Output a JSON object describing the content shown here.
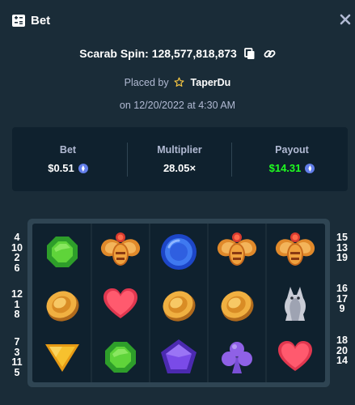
{
  "modal": {
    "title": "Bet"
  },
  "spin": {
    "label": "Scarab Spin: 128,577,818,873"
  },
  "placed": {
    "prefix": "Placed by",
    "user": "TaperDu"
  },
  "date": "on 12/20/2022 at 4:30 AM",
  "stats": {
    "bet": {
      "label": "Bet",
      "value": "$0.51"
    },
    "multiplier": {
      "label": "Multiplier",
      "value": "28.05×"
    },
    "payout": {
      "label": "Payout",
      "value": "$14.31"
    }
  },
  "paylines": {
    "left": [
      [
        "4",
        "10",
        "2",
        "6"
      ],
      [
        "12",
        "1",
        "8"
      ],
      [
        "7",
        "3",
        "11",
        "5"
      ]
    ],
    "right": [
      [
        "15",
        "13",
        "19"
      ],
      [
        "16",
        "17",
        "9"
      ],
      [
        "18",
        "20",
        "14"
      ]
    ]
  },
  "reels": [
    [
      "green-gem",
      "coin",
      "yellow-triangle"
    ],
    [
      "scarab",
      "heart",
      "green-gem"
    ],
    [
      "blue-gem",
      "coin",
      "purple-pentagon"
    ],
    [
      "scarab",
      "coin",
      "club"
    ],
    [
      "scarab",
      "cat",
      "heart"
    ]
  ],
  "colors": {
    "background": "#1a2c38",
    "panel": "#0f212e",
    "frame": "#2f4553",
    "payout": "#1fff20",
    "muted": "#b1bad3"
  }
}
